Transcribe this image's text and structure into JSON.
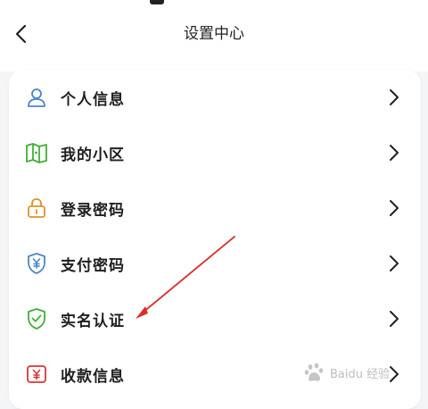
{
  "header": {
    "title": "设置中心"
  },
  "settings": {
    "items": [
      {
        "label": "个人信息",
        "icon": "user-icon",
        "color": "#4a86c8"
      },
      {
        "label": "我的小区",
        "icon": "community-map-icon",
        "color": "#3cb033"
      },
      {
        "label": "登录密码",
        "icon": "lock-icon",
        "color": "#e0912a"
      },
      {
        "label": "支付密码",
        "icon": "yuan-shield-icon",
        "color": "#4a86c8"
      },
      {
        "label": "实名认证",
        "icon": "check-shield-icon",
        "color": "#3cb033"
      },
      {
        "label": "收款信息",
        "icon": "yuan-card-icon",
        "color": "#d93636"
      }
    ]
  },
  "annotation": {
    "arrow_color": "#d9302c"
  },
  "watermark": {
    "text": "Baidu 经验"
  }
}
